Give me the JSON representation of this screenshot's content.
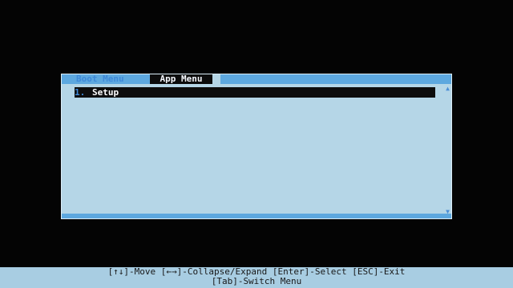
{
  "menu": {
    "tabs": [
      {
        "label": "Boot Menu"
      },
      {
        "label": "App Menu"
      }
    ],
    "items": [
      {
        "number": "1.",
        "label": "Setup"
      }
    ]
  },
  "help": {
    "line1": "[↑↓]-Move [←→]-Collapse/Expand [Enter]-Select [ESC]-Exit",
    "line2": "[Tab]-Switch Menu"
  },
  "colors": {
    "background": "#040404",
    "panel": "#b5d6e7",
    "accent": "#5da8df",
    "selected_bg": "#0d0d0d",
    "selected_text": "#ffffff"
  },
  "icons": {
    "scroll_up": "scroll-up-icon",
    "scroll_down": "scroll-down-icon"
  }
}
